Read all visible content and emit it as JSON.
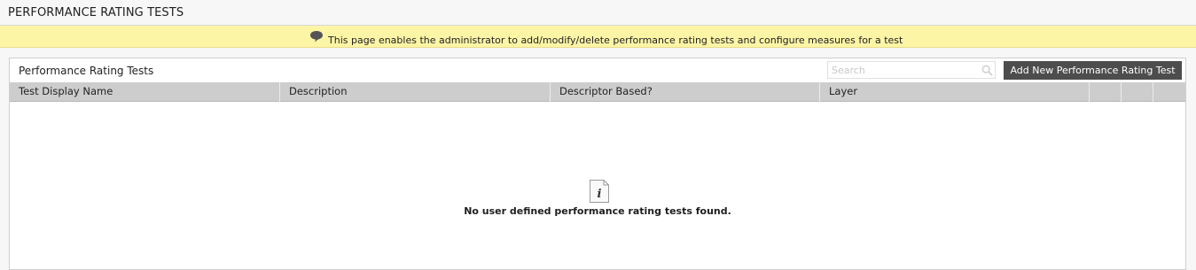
{
  "page": {
    "title": "PERFORMANCE RATING TESTS"
  },
  "banner": {
    "icon": "speech-bubble-icon",
    "text": "This page enables the administrator to add/modify/delete performance rating tests and configure measures for a test"
  },
  "panel": {
    "title": "Performance Rating Tests",
    "search": {
      "placeholder": "Search",
      "value": "",
      "icon": "search-icon"
    },
    "add_button_label": "Add New Performance Rating Test",
    "columns": [
      "Test Display Name",
      "Description",
      "Descriptor Based?",
      "Layer",
      "",
      "",
      ""
    ],
    "rows": [],
    "empty_state": {
      "icon": "info-document-icon",
      "message": "No user defined performance rating tests found."
    }
  },
  "colors": {
    "banner_background": "#fdf5a6",
    "button_background": "#4d4d4d",
    "table_header_background": "#cdcdcd"
  }
}
